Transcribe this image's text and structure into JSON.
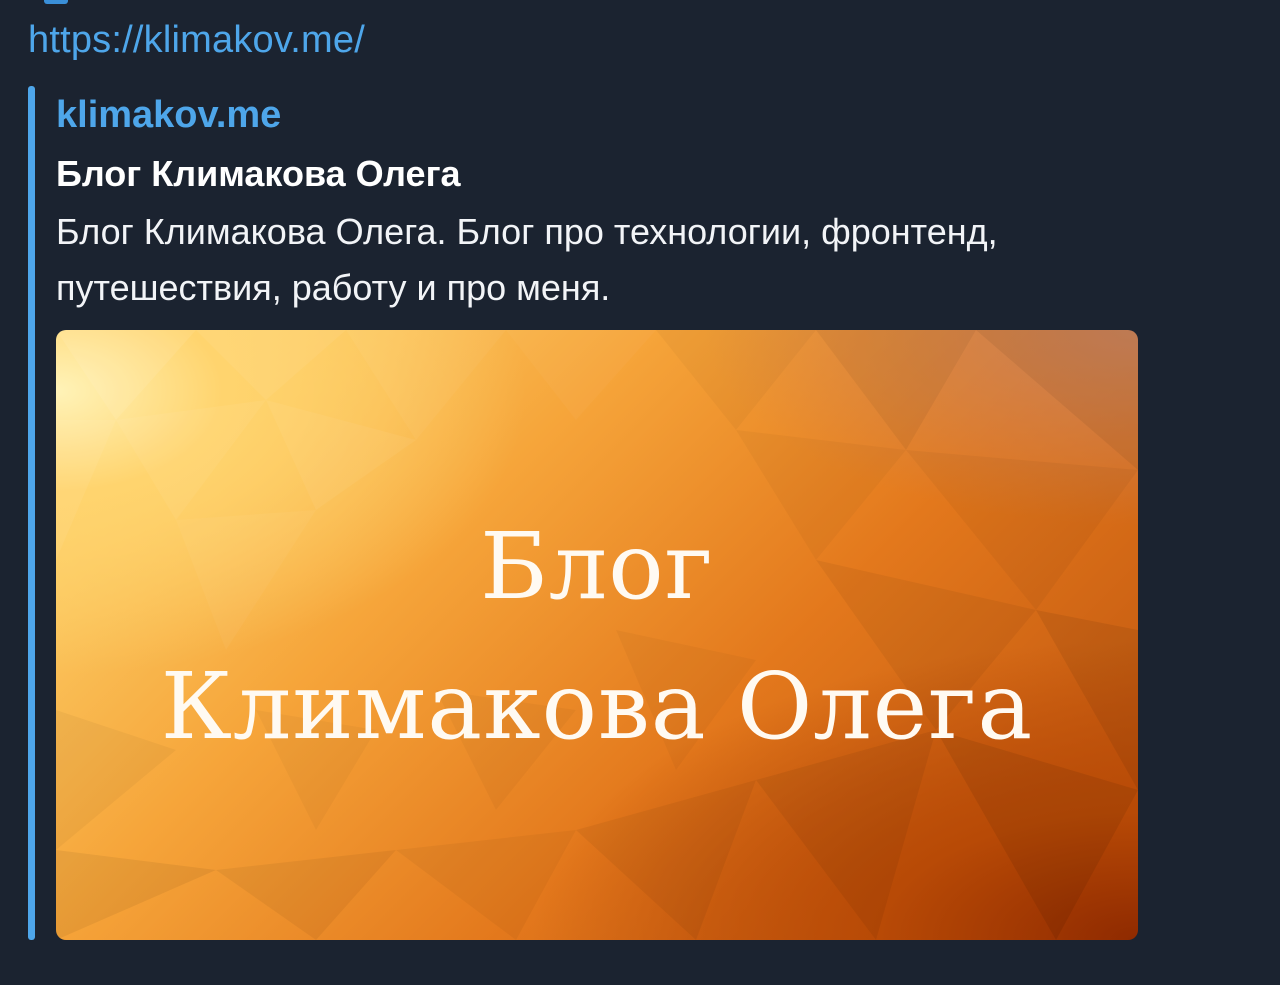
{
  "message": {
    "link_text": "https://klimakov.me/"
  },
  "link_preview": {
    "site_name": "klimakov.me",
    "title": "Блог Климакова Олега",
    "description": "Блог Климакова Олега. Блог про технологии, фронтенд, путешествия, работу и про меня.",
    "image": {
      "line1": "Блог",
      "line2": "Климакова Олега"
    }
  },
  "colors": {
    "background": "#1b2330",
    "accent": "#4ea6ea",
    "text": "#ffffff",
    "image_gradient": [
      "#ffe07a",
      "#f6a53a",
      "#e3781c",
      "#b84e0c"
    ]
  }
}
